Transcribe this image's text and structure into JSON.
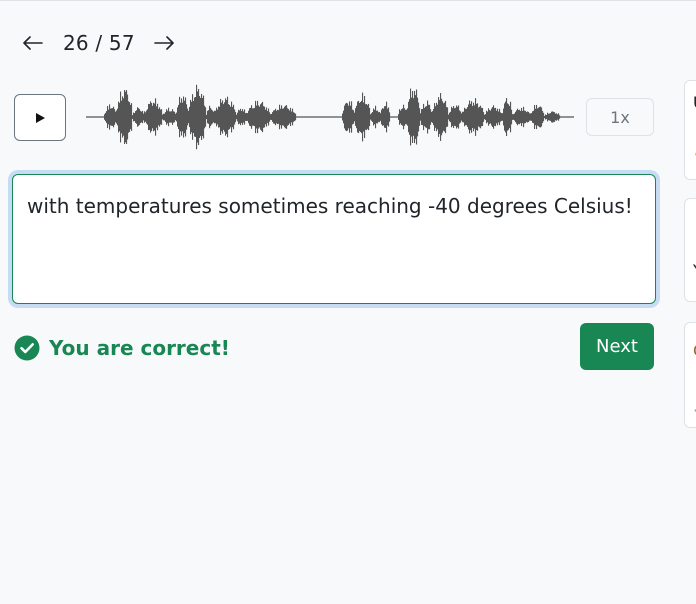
{
  "nav": {
    "counter": "26 / 57",
    "prev_icon": "arrow-left-icon",
    "next_icon": "arrow-right-icon"
  },
  "player": {
    "play_icon": "play-icon",
    "speed_label": "1x",
    "waveform_color": "#555555"
  },
  "answer": {
    "text": "with temperatures sometimes reaching -40 degrees Celsius!"
  },
  "feedback": {
    "icon": "check-circle-icon",
    "message": "You are correct!",
    "color": "#198754"
  },
  "actions": {
    "next_label": "Next",
    "accent": "#198754"
  }
}
